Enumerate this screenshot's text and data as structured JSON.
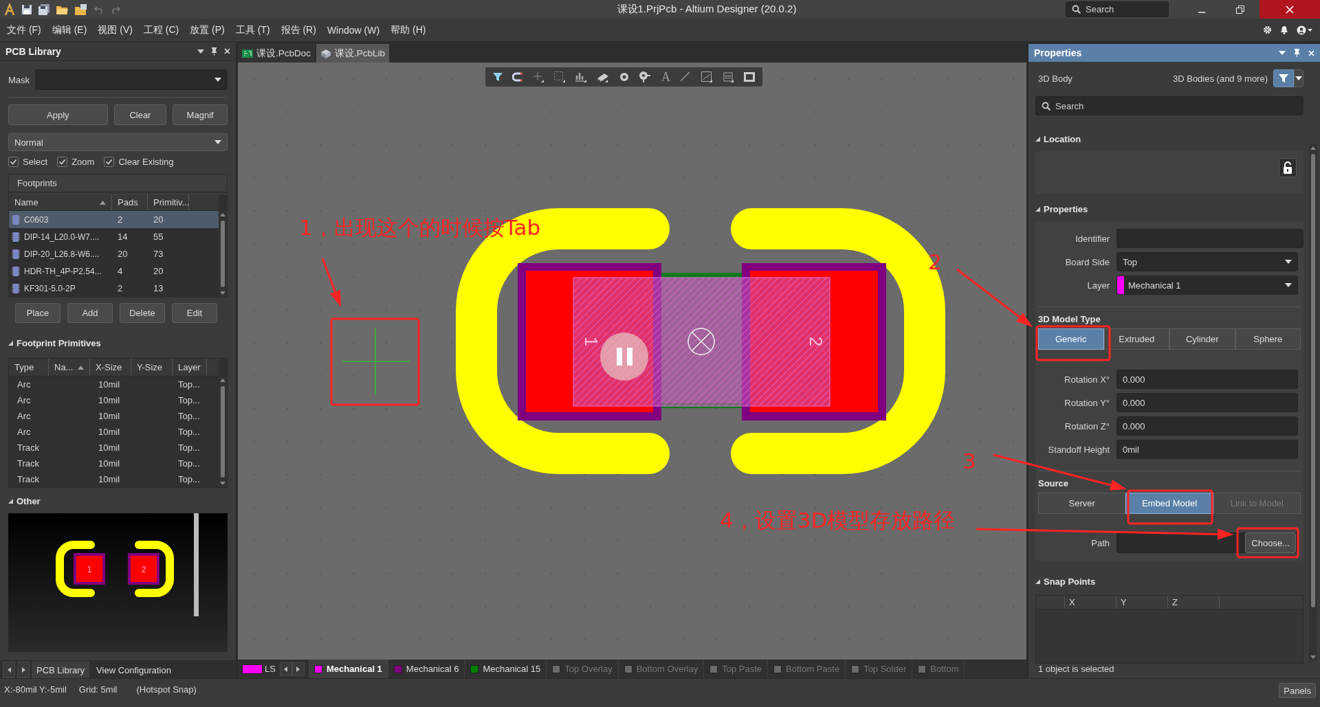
{
  "window": {
    "title": "课设1.PrjPcb - Altium Designer (20.0.2)",
    "search": {
      "placeholder": "Search"
    }
  },
  "menu": [
    "文件 (F)",
    "编辑 (E)",
    "视图 (V)",
    "工程 (C)",
    "放置 (P)",
    "工具 (T)",
    "报告 (R)",
    "Window (W)",
    "帮助 (H)"
  ],
  "documents": [
    {
      "label": "课设.PcbDoc",
      "kind": "pcb",
      "selected": false
    },
    {
      "label": "课设.PcbLib",
      "kind": "lib",
      "selected": true
    }
  ],
  "library_panel": {
    "title": "PCB Library",
    "mask": {
      "label": "Mask"
    },
    "buttons": [
      "Apply",
      "Clear",
      "Magnif"
    ],
    "mode": "Normal",
    "options": [
      {
        "label": "Select",
        "checked": true
      },
      {
        "label": "Zoom",
        "checked": true
      },
      {
        "label": "Clear Existing",
        "checked": true
      }
    ],
    "footprints": {
      "title": "Footprints",
      "columns": [
        "Name",
        "Pads",
        "Primitiv..."
      ],
      "rows": [
        {
          "name": "C0603",
          "pads": "2",
          "primitives": "20",
          "selected": true
        },
        {
          "name": "DIP-14_L20.0-W7....",
          "pads": "14",
          "primitives": "55",
          "selected": false
        },
        {
          "name": "DIP-20_L26.8-W6....",
          "pads": "20",
          "primitives": "73",
          "selected": false
        },
        {
          "name": "HDR-TH_4P-P2.54...",
          "pads": "4",
          "primitives": "20",
          "selected": false
        },
        {
          "name": "KF301-5.0-2P",
          "pads": "2",
          "primitives": "13",
          "selected": false
        }
      ]
    },
    "footprint_buttons": [
      "Place",
      "Add",
      "Delete",
      "Edit"
    ],
    "primitives": {
      "title": "Footprint Primitives",
      "columns": [
        "Type",
        "Na...",
        "X-Size",
        "Y-Size",
        "Layer"
      ],
      "rows": [
        {
          "type": "Arc",
          "x_size": "10mil",
          "layer": "Top..."
        },
        {
          "type": "Arc",
          "x_size": "10mil",
          "layer": "Top..."
        },
        {
          "type": "Arc",
          "x_size": "10mil",
          "layer": "Top..."
        },
        {
          "type": "Arc",
          "x_size": "10mil",
          "layer": "Top..."
        },
        {
          "type": "Track",
          "x_size": "10mil",
          "layer": "Top..."
        },
        {
          "type": "Track",
          "x_size": "10mil",
          "layer": "Top..."
        },
        {
          "type": "Track",
          "x_size": "10mil",
          "layer": "Top..."
        }
      ]
    },
    "other": {
      "title": "Other",
      "pad_labels": [
        "1",
        "2"
      ]
    },
    "tabs": [
      {
        "label": "PCB Library",
        "selected": true
      },
      {
        "label": "View Configuration",
        "selected": false
      }
    ]
  },
  "canvas": {
    "text_tool_glyph": "A",
    "pad_labels": [
      "1",
      "2"
    ],
    "current_layer": {
      "label": "LS",
      "color": "#ff00ff"
    },
    "layers": [
      {
        "label": "Mechanical 1",
        "color": "#ff00ff",
        "selected": true,
        "enabled": true
      },
      {
        "label": "Mechanical 6",
        "color": "#800080",
        "selected": false,
        "enabled": true
      },
      {
        "label": "Mechanical 15",
        "color": "#008000",
        "selected": false,
        "enabled": true
      },
      {
        "label": "Top Overlay",
        "color": "#6a6a6a",
        "selected": false,
        "enabled": false
      },
      {
        "label": "Bottom Overlay",
        "color": "#6a6a6a",
        "selected": false,
        "enabled": false
      },
      {
        "label": "Top Paste",
        "color": "#6a6a6a",
        "selected": false,
        "enabled": false
      },
      {
        "label": "Bottom Paste",
        "color": "#6a6a6a",
        "selected": false,
        "enabled": false
      },
      {
        "label": "Top Solder",
        "color": "#6a6a6a",
        "selected": false,
        "enabled": false
      },
      {
        "label": "Bottom",
        "color": "#6a6a6a",
        "selected": false,
        "enabled": false
      }
    ]
  },
  "properties_panel": {
    "title": "Properties",
    "object": "3D Body",
    "filter": "3D Bodies (and 9 more)",
    "search": {
      "placeholder": "Search"
    },
    "location": {
      "title": "Location"
    },
    "properties": {
      "title": "Properties",
      "fields": [
        {
          "label": "Identifier",
          "kind": "text"
        },
        {
          "label": "Board Side",
          "kind": "dropdown",
          "value": "Top"
        },
        {
          "label": "Layer",
          "kind": "layer",
          "value": "Mechanical 1",
          "color": "#ff00ff"
        }
      ]
    },
    "model_type": {
      "title": "3D Model Type",
      "options": [
        {
          "label": "Generic",
          "selected": true
        },
        {
          "label": "Extruded",
          "selected": false
        },
        {
          "label": "Cylinder",
          "selected": false
        },
        {
          "label": "Sphere",
          "selected": false
        }
      ]
    },
    "model_fields": [
      {
        "label": "Rotation X°",
        "value": "0.000"
      },
      {
        "label": "Rotation Y°",
        "value": "0.000"
      },
      {
        "label": "Rotation Z°",
        "value": "0.000"
      },
      {
        "label": "Standoff Height",
        "value": "0mil"
      }
    ],
    "source": {
      "title": "Source",
      "options": [
        {
          "label": "Server",
          "selected": false,
          "disabled": false
        },
        {
          "label": "Embed Model",
          "selected": true,
          "disabled": false
        },
        {
          "label": "Link to Model",
          "selected": false,
          "disabled": true
        }
      ],
      "path": {
        "label": "Path",
        "button": "Choose..."
      }
    },
    "snap_points": {
      "title": "Snap Points",
      "columns": [
        "X",
        "Y",
        "Z"
      ]
    },
    "selection": "1 object is selected"
  },
  "status_bar": {
    "coords": "X:-80mil Y:-5mil",
    "grid": "Grid: 5mil",
    "snap": "(Hotspot Snap)",
    "panels_button": "Panels"
  },
  "annotations": [
    {
      "text": "1，出现这个的时候按Tab"
    },
    {
      "text": "2"
    },
    {
      "text": "3"
    },
    {
      "text": "4，设置3D模型存放路径"
    }
  ]
}
